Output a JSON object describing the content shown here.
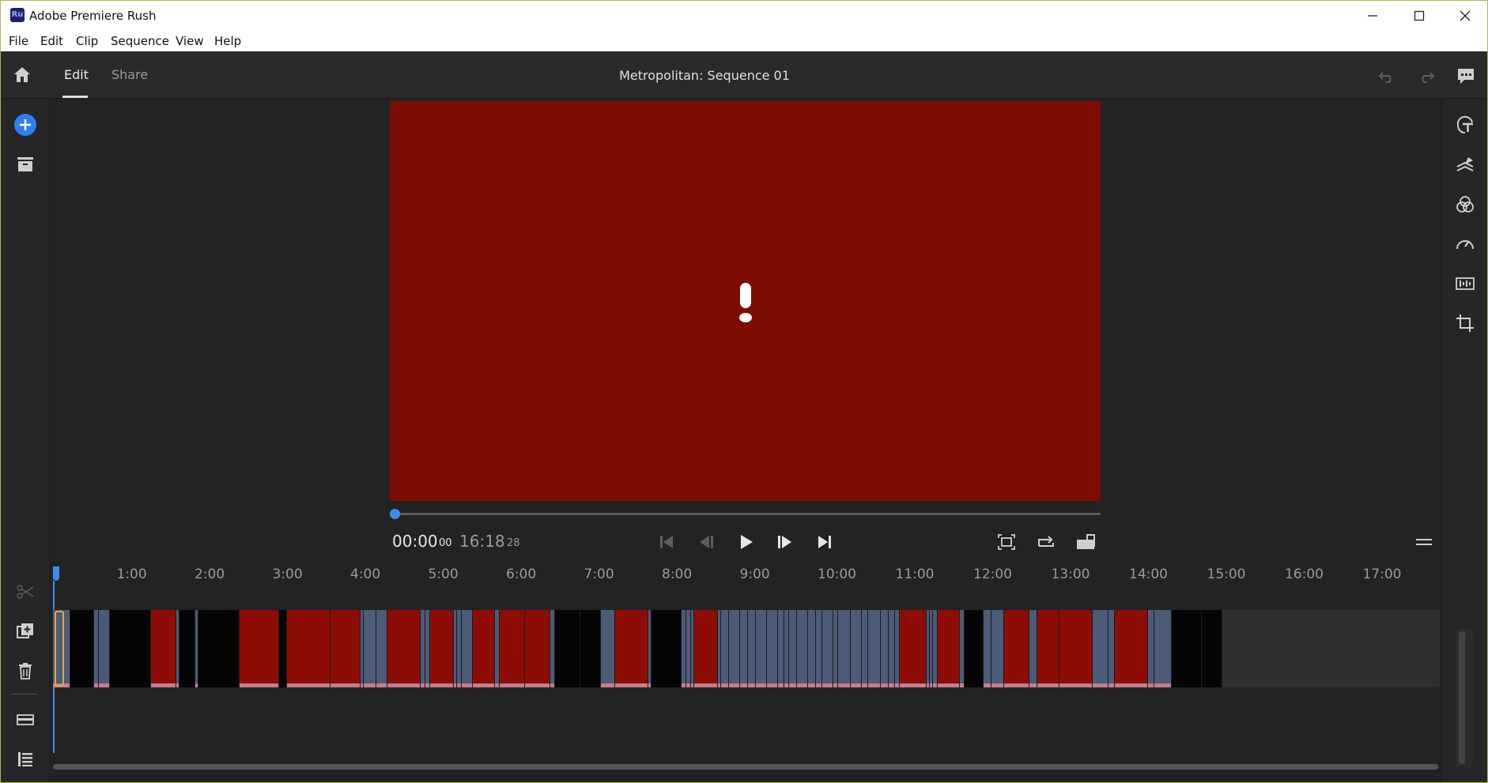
{
  "window": {
    "title": "Adobe Premiere Rush",
    "app_logo": "Ru"
  },
  "menu": [
    "File",
    "Edit",
    "Clip",
    "Sequence",
    "View",
    "Help"
  ],
  "header": {
    "tabs": [
      {
        "label": "Edit",
        "active": true
      },
      {
        "label": "Share",
        "active": false
      }
    ],
    "sequence_title": "Metropolitan: Sequence 01"
  },
  "left_toolbar": [
    "add-media-icon",
    "project-assets-icon",
    "split-clip-icon",
    "duplicate-icon",
    "delete-icon",
    "track-controls-icon",
    "sequence-list-icon"
  ],
  "right_toolbar": [
    "titles-icon",
    "transitions-icon",
    "color-icon",
    "speed-icon",
    "audio-icon",
    "transform-icon"
  ],
  "playback": {
    "current_time": "00:00",
    "current_frames": "00",
    "duration_time": "16:18",
    "duration_frames": "28",
    "progress": 0
  },
  "timeline": {
    "ruler_labels": [
      "1:00",
      "2:00",
      "3:00",
      "4:00",
      "5:00",
      "6:00",
      "7:00",
      "8:00",
      "9:00",
      "10:00",
      "11:00",
      "12:00",
      "13:00",
      "14:00",
      "15:00",
      "16:00",
      "17:00"
    ]
  },
  "colors": {
    "accent": "#3b8ef0",
    "preview_bg": "#7d0d02",
    "clip_red": "#8e0c06",
    "clip_blue": "#4b5b78",
    "clip_black": "#050505",
    "selection": "#e7a83a"
  }
}
